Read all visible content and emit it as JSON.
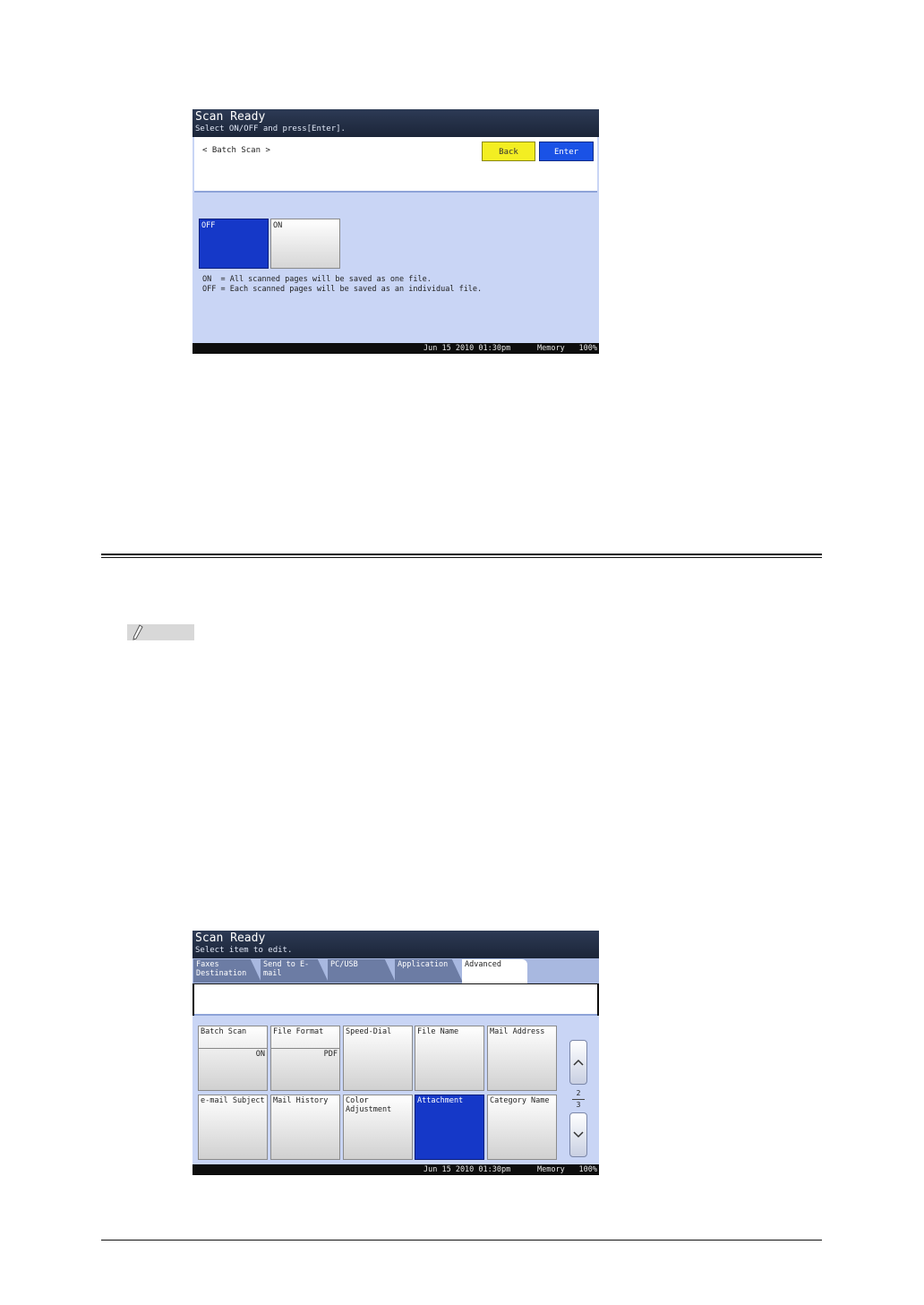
{
  "screen1": {
    "title": "Scan Ready",
    "subtitle": "Select ON/OFF and press[Enter].",
    "breadcrumb": "< Batch Scan >",
    "back_label": "Back",
    "enter_label": "Enter",
    "options": [
      {
        "label": "OFF",
        "selected": true
      },
      {
        "label": "ON",
        "selected": false
      }
    ],
    "description_on": "ON  = All scanned pages will be saved as one file.",
    "description_off": "OFF = Each scanned pages will be saved as an individual file.",
    "status": {
      "date": "Jun 15 2010 01:30pm",
      "memory_label": "Memory",
      "memory_value": "100%"
    }
  },
  "screen2": {
    "title": "Scan Ready",
    "subtitle": "Select item to edit.",
    "tabs": [
      {
        "label": "Faxes Destination",
        "active": false
      },
      {
        "label": "Send to E-mail",
        "active": false
      },
      {
        "label": "PC/USB",
        "active": false
      },
      {
        "label": "Application",
        "active": false
      },
      {
        "label": "Advanced",
        "active": true
      }
    ],
    "items": [
      {
        "label": "Batch Scan",
        "value": "ON",
        "selected": false
      },
      {
        "label": "File Format",
        "value": "PDF",
        "selected": false
      },
      {
        "label": "Speed-Dial",
        "value": "",
        "selected": false
      },
      {
        "label": "File Name",
        "value": "",
        "selected": false
      },
      {
        "label": "Mail Address",
        "value": "",
        "selected": false
      },
      {
        "label": "e-mail Subject",
        "value": "",
        "selected": false
      },
      {
        "label": "Mail History",
        "value": "",
        "selected": false
      },
      {
        "label": "Color Adjustment",
        "value": "",
        "selected": false
      },
      {
        "label": "Attachment",
        "value": "",
        "selected": true
      },
      {
        "label": "Category Name",
        "value": "",
        "selected": false
      }
    ],
    "page_current": "2",
    "page_total": "3",
    "status": {
      "date": "Jun 15 2010 01:30pm",
      "memory_label": "Memory",
      "memory_value": "100%"
    }
  },
  "icons": {
    "scroll_up": "chevron-up-icon",
    "scroll_down": "chevron-down-icon",
    "note": "pencil-icon"
  }
}
